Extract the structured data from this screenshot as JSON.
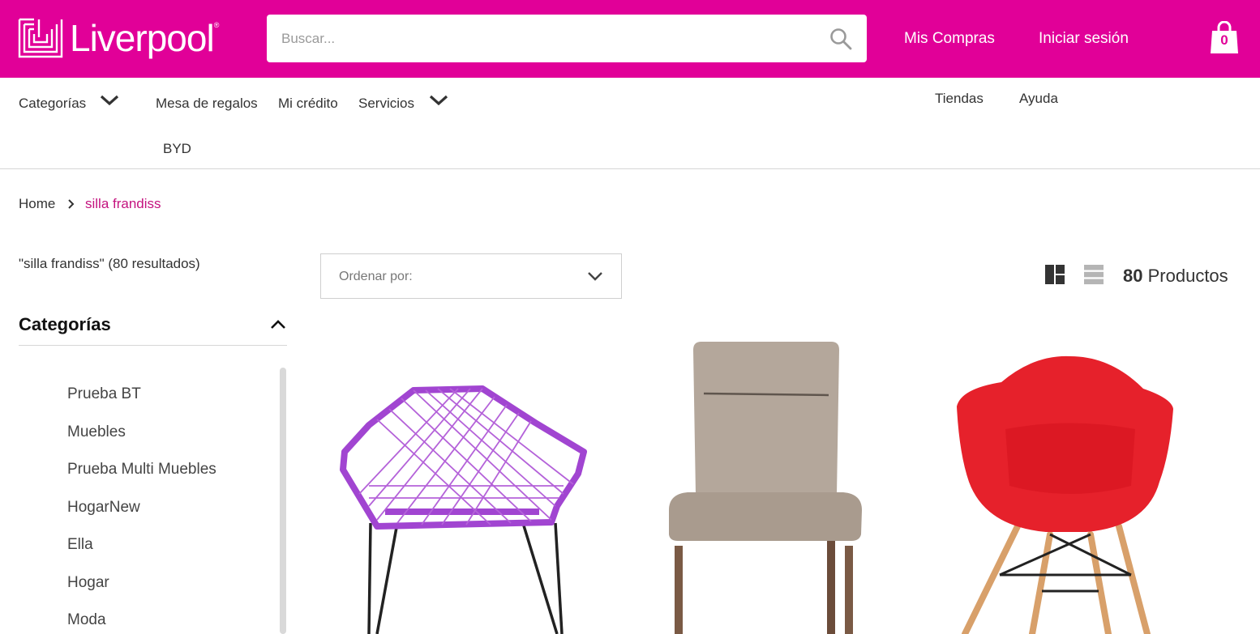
{
  "header": {
    "brand": "Liverpool",
    "search_placeholder": "Buscar...",
    "links": [
      "Mis Compras",
      "Iniciar sesión"
    ],
    "cart_count": "0",
    "brand_color": "#e10098"
  },
  "nav": {
    "categories": "Categorías",
    "gift_registry": "Mesa de regalos",
    "credit": "Mi crédito",
    "services": "Servicios",
    "byd": "BYD",
    "stores": "Tiendas",
    "help": "Ayuda"
  },
  "breadcrumb": {
    "home": "Home",
    "current": "silla frandiss"
  },
  "sidebar": {
    "results_text": "\"silla frandiss\" (80 resultados)",
    "categories_title": "Categorías",
    "categories": [
      "Prueba BT",
      "Muebles",
      "Prueba Multi Muebles",
      "HogarNew",
      "Ella",
      "Hogar",
      "Moda"
    ]
  },
  "toolbar": {
    "sort_label": "Ordenar por:",
    "product_count": "80",
    "product_count_label": "Productos"
  },
  "products": [
    {
      "icon": "purple-woven-chair-image"
    },
    {
      "icon": "beige-upholstered-chair-image"
    },
    {
      "icon": "red-eames-chair-image"
    }
  ]
}
